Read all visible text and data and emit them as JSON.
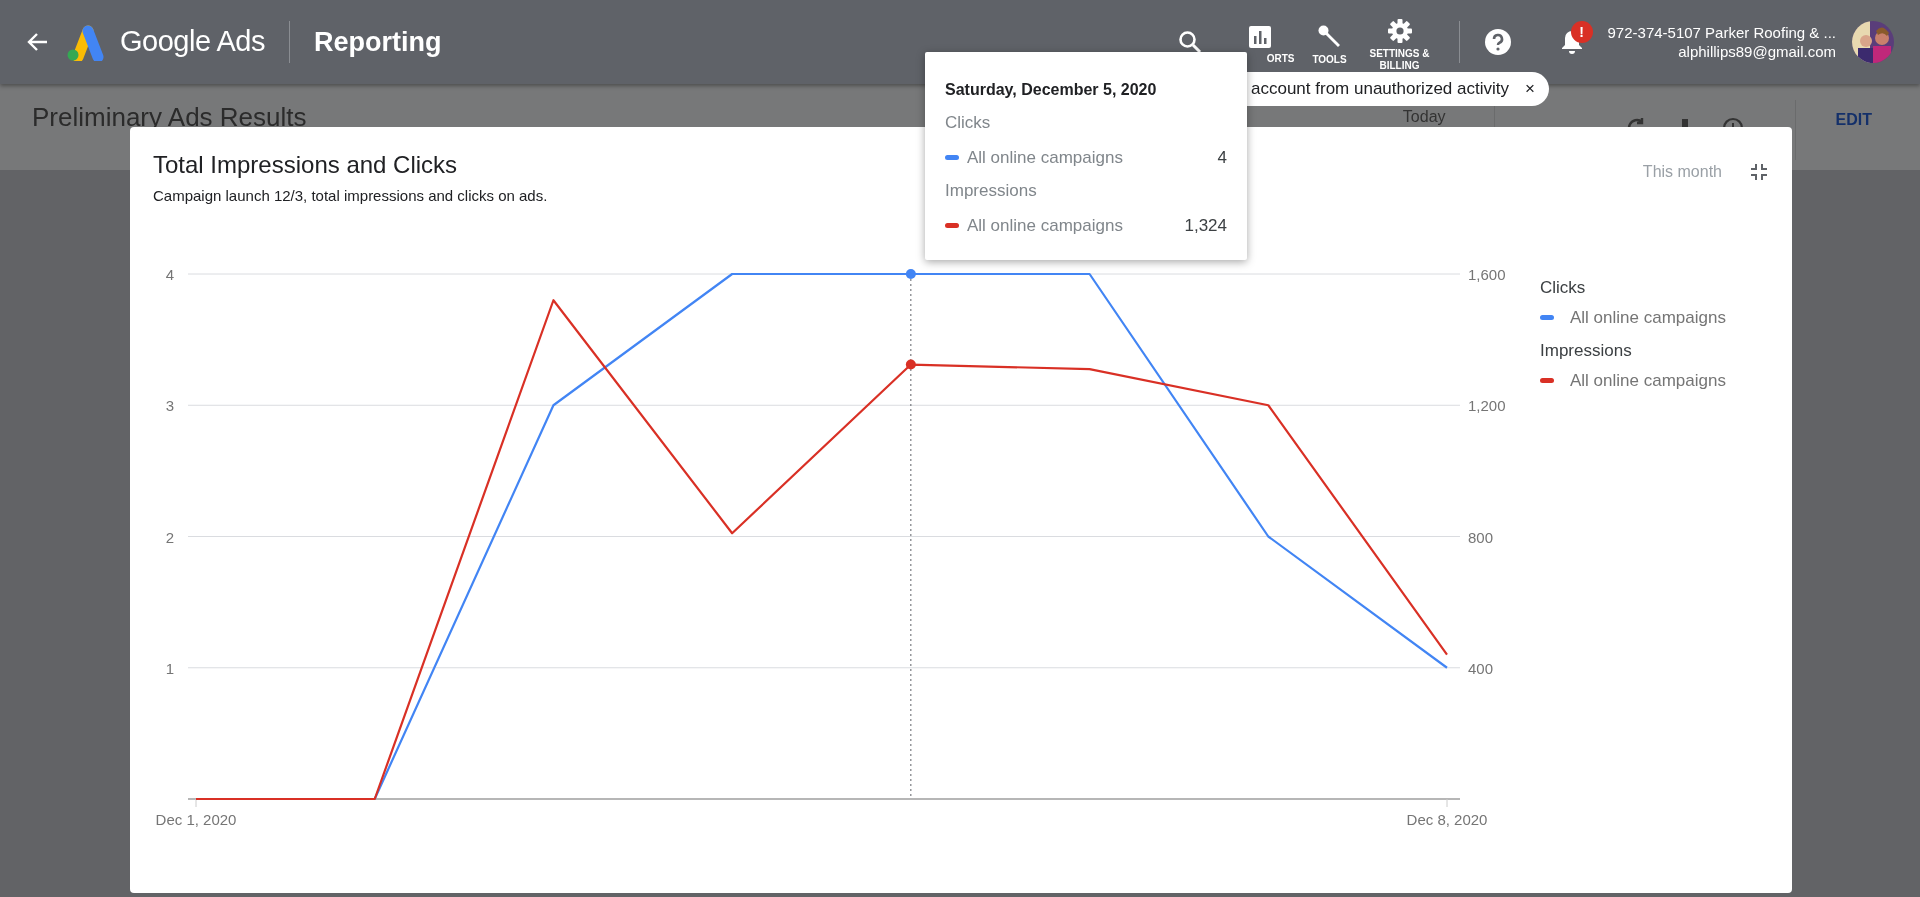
{
  "header": {
    "product": "Google Ads",
    "section": "Reporting",
    "nav": [
      {
        "kind": "search"
      },
      {
        "kind": "reports",
        "label": "ORTS"
      },
      {
        "kind": "tools",
        "label": "TOOLS"
      },
      {
        "kind": "settings",
        "label": "SETTINGS & BILLING"
      }
    ],
    "notifications": {
      "badge": "!"
    },
    "account": {
      "name": "972-374-5107 Parker Roofing & ...",
      "email": "alphillips89@gmail.com"
    }
  },
  "alert_banner": {
    "text": "account from unauthorized activity",
    "close": "×"
  },
  "subheader": {
    "title": "Preliminary Ads Results",
    "date_range": "Today",
    "edit": "EDIT"
  },
  "chart_card": {
    "title": "Total Impressions and Clicks",
    "subtitle": "Campaign launch 12/3, total impressions and clicks on ads.",
    "range": "This month",
    "legend": [
      {
        "heading": "Clicks"
      },
      {
        "heading": "Impressions"
      }
    ],
    "chart_data": {
      "type": "line",
      "categories": [
        "Dec 1, 2020",
        null,
        null,
        null,
        null,
        null,
        null,
        "Dec 8, 2020"
      ],
      "ylim": [
        0,
        4
      ],
      "yticks": [
        1,
        2,
        3,
        4
      ],
      "y2lim": [
        0,
        1600
      ],
      "y2ticks": [
        {
          "value": 400,
          "label": "400"
        },
        {
          "value": 800,
          "label": "800"
        },
        {
          "value": 1200,
          "label": "1,200"
        },
        {
          "value": 1600,
          "label": "1,600"
        }
      ],
      "series": [
        {
          "name": "All online campaigns",
          "color": "#4285f4",
          "values": [
            0,
            0,
            3,
            4,
            4,
            4,
            2,
            1
          ]
        },
        {
          "name": "All online campaigns",
          "color": "#d93025",
          "axis": "y2",
          "values": [
            0,
            0,
            1520,
            810,
            1324,
            1310,
            1200,
            440
          ]
        }
      ],
      "grid": true
    }
  },
  "tooltip": {
    "title": "Saturday, December 5, 2020",
    "rows": [
      {
        "heading": "Clicks",
        "label": "All online campaigns",
        "value": "4",
        "color": "#4285f4"
      },
      {
        "heading": "Impressions",
        "label": "All online campaigns",
        "value": "1,324",
        "color": "#d93025"
      }
    ]
  }
}
